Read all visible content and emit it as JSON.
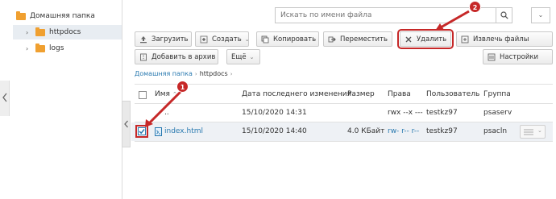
{
  "sidebar": {
    "items": [
      {
        "label": "Домашняя папка",
        "level": 0,
        "selected": false
      },
      {
        "label": "httpdocs",
        "level": 1,
        "selected": true
      },
      {
        "label": "logs",
        "level": 1,
        "selected": false
      }
    ]
  },
  "search": {
    "placeholder": "Искать по имени файла"
  },
  "toolbar": {
    "upload": "Загрузить",
    "create": "Создать",
    "copy": "Копировать",
    "move": "Переместить",
    "delete": "Удалить",
    "extract": "Извлечь файлы",
    "add_archive": "Добавить в архив",
    "more": "Ещё",
    "settings": "Настройки"
  },
  "breadcrumb": {
    "items": [
      "Домашняя папка",
      "httpdocs"
    ]
  },
  "table": {
    "columns": [
      "Имя",
      "Дата последнего изменения",
      "Размер",
      "Права",
      "Пользователь",
      "Группа"
    ],
    "rows": [
      {
        "name": "..",
        "modified": "15/10/2020 14:31",
        "size": "",
        "perms": "rwx --x ---",
        "user": "testkz97",
        "group": "psaserv",
        "checked": false
      },
      {
        "name": "index.html",
        "modified": "15/10/2020 14:40",
        "size": "4.0 КБайт",
        "perms": "rw- r-- r--",
        "user": "testkz97",
        "group": "psacln",
        "checked": true
      }
    ]
  },
  "annotations": [
    {
      "number": "1",
      "color": "#c62828"
    },
    {
      "number": "2",
      "color": "#c62828"
    }
  ],
  "colors": {
    "accent": "#2a7ab0",
    "annotation": "#c62828",
    "folder": "#f0a030"
  }
}
